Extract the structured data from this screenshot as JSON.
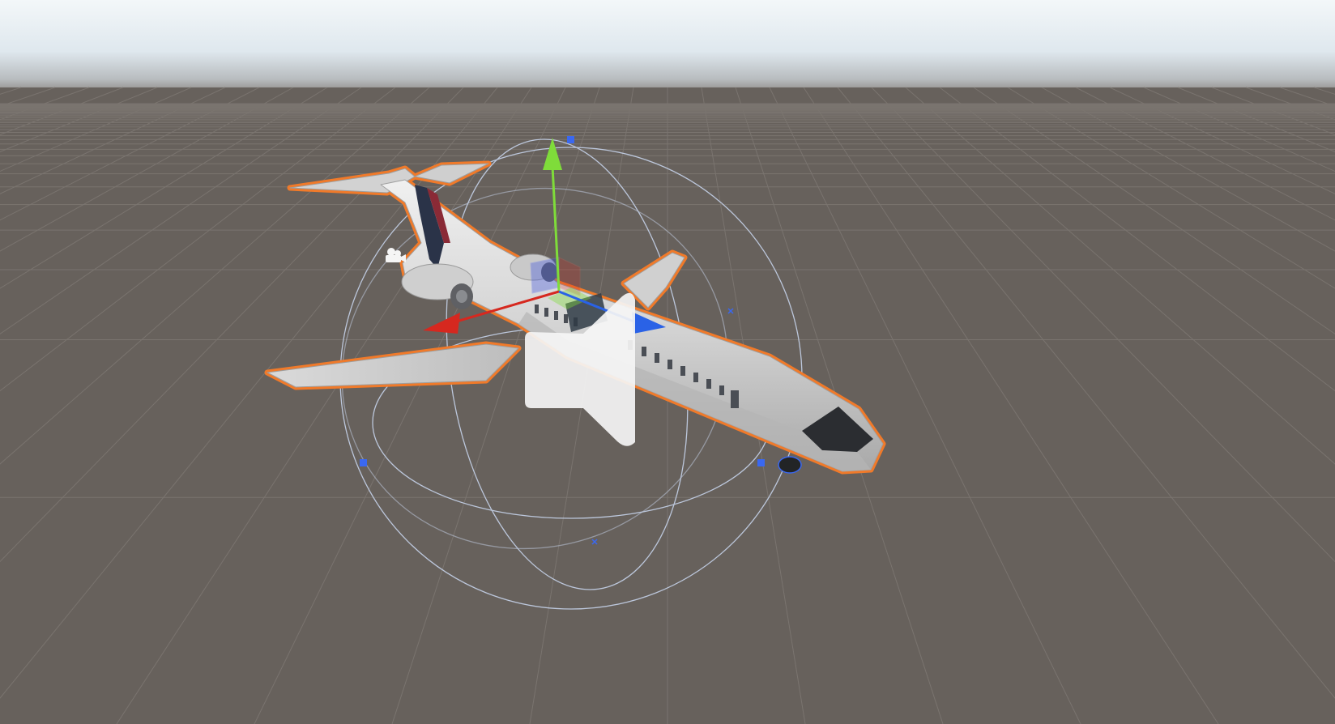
{
  "scene": {
    "colors": {
      "sky_top": "#f3f7f9",
      "sky_mid": "#dfe8ee",
      "horizon": "#98999a",
      "ground": "#67615c",
      "grid_line": "#7a746f",
      "selection_outline": "#f07a2a",
      "gizmo_x_axis": "#d6281f",
      "gizmo_y_axis": "#7fdc3a",
      "gizmo_z_axis": "#2a62e6",
      "collider_wire": "#c6d3ea",
      "collider_handle": "#3a68f0",
      "fuselage": "#d9d9d9",
      "tail_stripe": "#2a3348",
      "cockpit_glass": "#2b2d31",
      "audio_icon": "#f5f5f5"
    },
    "gizmos": {
      "move_tool": "translate-gizmo",
      "collider": "sphere-collider-gizmo",
      "audio_source": "speaker-icon",
      "camera": "camera-icon"
    }
  }
}
